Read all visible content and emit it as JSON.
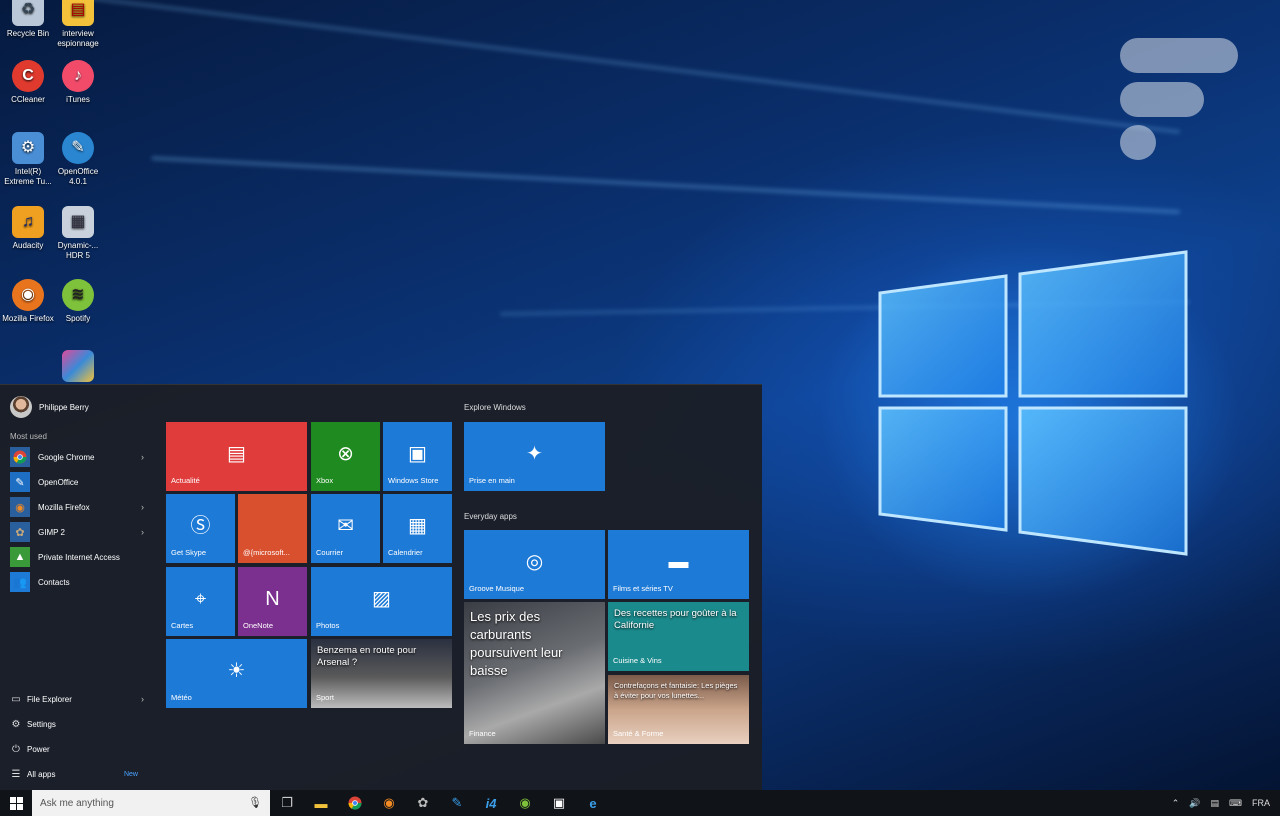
{
  "desktop": {
    "icons": [
      {
        "label": "Recycle Bin",
        "icon": "recycle-bin-icon"
      },
      {
        "label": "interview espionnage",
        "icon": "archive-icon"
      },
      {
        "label": "CCleaner",
        "icon": "ccleaner-icon"
      },
      {
        "label": "iTunes",
        "icon": "itunes-icon"
      },
      {
        "label": "Intel(R) Extreme Tu...",
        "icon": "intel-icon"
      },
      {
        "label": "OpenOffice 4.0.1",
        "icon": "openoffice-icon"
      },
      {
        "label": "Audacity",
        "icon": "audacity-icon"
      },
      {
        "label": "Dynamic-... HDR 5",
        "icon": "hdr-icon"
      },
      {
        "label": "Mozilla Firefox",
        "icon": "firefox-icon"
      },
      {
        "label": "Spotify",
        "icon": "spotify-icon"
      }
    ]
  },
  "start_menu": {
    "user_name": "Philippe Berry",
    "most_used_label": "Most used",
    "most_used": [
      {
        "label": "Google Chrome",
        "icon": "chrome-icon",
        "has_submenu": true
      },
      {
        "label": "OpenOffice",
        "icon": "openoffice-icon",
        "has_submenu": false
      },
      {
        "label": "Mozilla Firefox",
        "icon": "firefox-icon",
        "has_submenu": true
      },
      {
        "label": "GIMP 2",
        "icon": "gimp-icon",
        "has_submenu": true
      },
      {
        "label": "Private Internet Access",
        "icon": "vpn-icon",
        "has_submenu": false
      },
      {
        "label": "Contacts",
        "icon": "contacts-icon",
        "has_submenu": false
      }
    ],
    "file_explorer": "File Explorer",
    "settings": "Settings",
    "power": "Power",
    "all_apps": "All apps",
    "new_badge": "New",
    "tiles": {
      "actualite": "Actualité",
      "xbox": "Xbox",
      "windows_store": "Windows Store",
      "get_skype": "Get Skype",
      "microsoft": "@{microsoft...",
      "courrier": "Courrier",
      "calendrier": "Calendrier",
      "cartes": "Cartes",
      "onenote": "OneNote",
      "photos": "Photos",
      "meteo": "Météo",
      "sport_headline": "Benzema en route pour Arsenal ?",
      "sport": "Sport"
    },
    "explore_label": "Explore Windows",
    "prise_en_main": "Prise en main",
    "everyday_label": "Everyday apps",
    "everyday_tiles": {
      "groove": "Groove Musique",
      "films": "Films et séries TV",
      "finance_headline": "Les prix des carburants poursuivent leur baisse",
      "finance": "Finance",
      "cuisine_headline": "Des recettes pour goûter à la Californie",
      "cuisine": "Cuisine & Vins",
      "sante_headline": "Contrefaçons et fantaisie: Les pièges à éviter pour vos lunettes...",
      "sante": "Santé & Forme"
    }
  },
  "taskbar": {
    "search_placeholder": "Ask me anything",
    "language": "FRA"
  },
  "colors": {
    "accent_blue": "#1e7ad7",
    "tile_red": "#e03c3c",
    "tile_green": "#1f8a1f",
    "tile_orange": "#d9502f",
    "tile_purple": "#7b2f8e",
    "tile_teal": "#1b8a8c"
  }
}
